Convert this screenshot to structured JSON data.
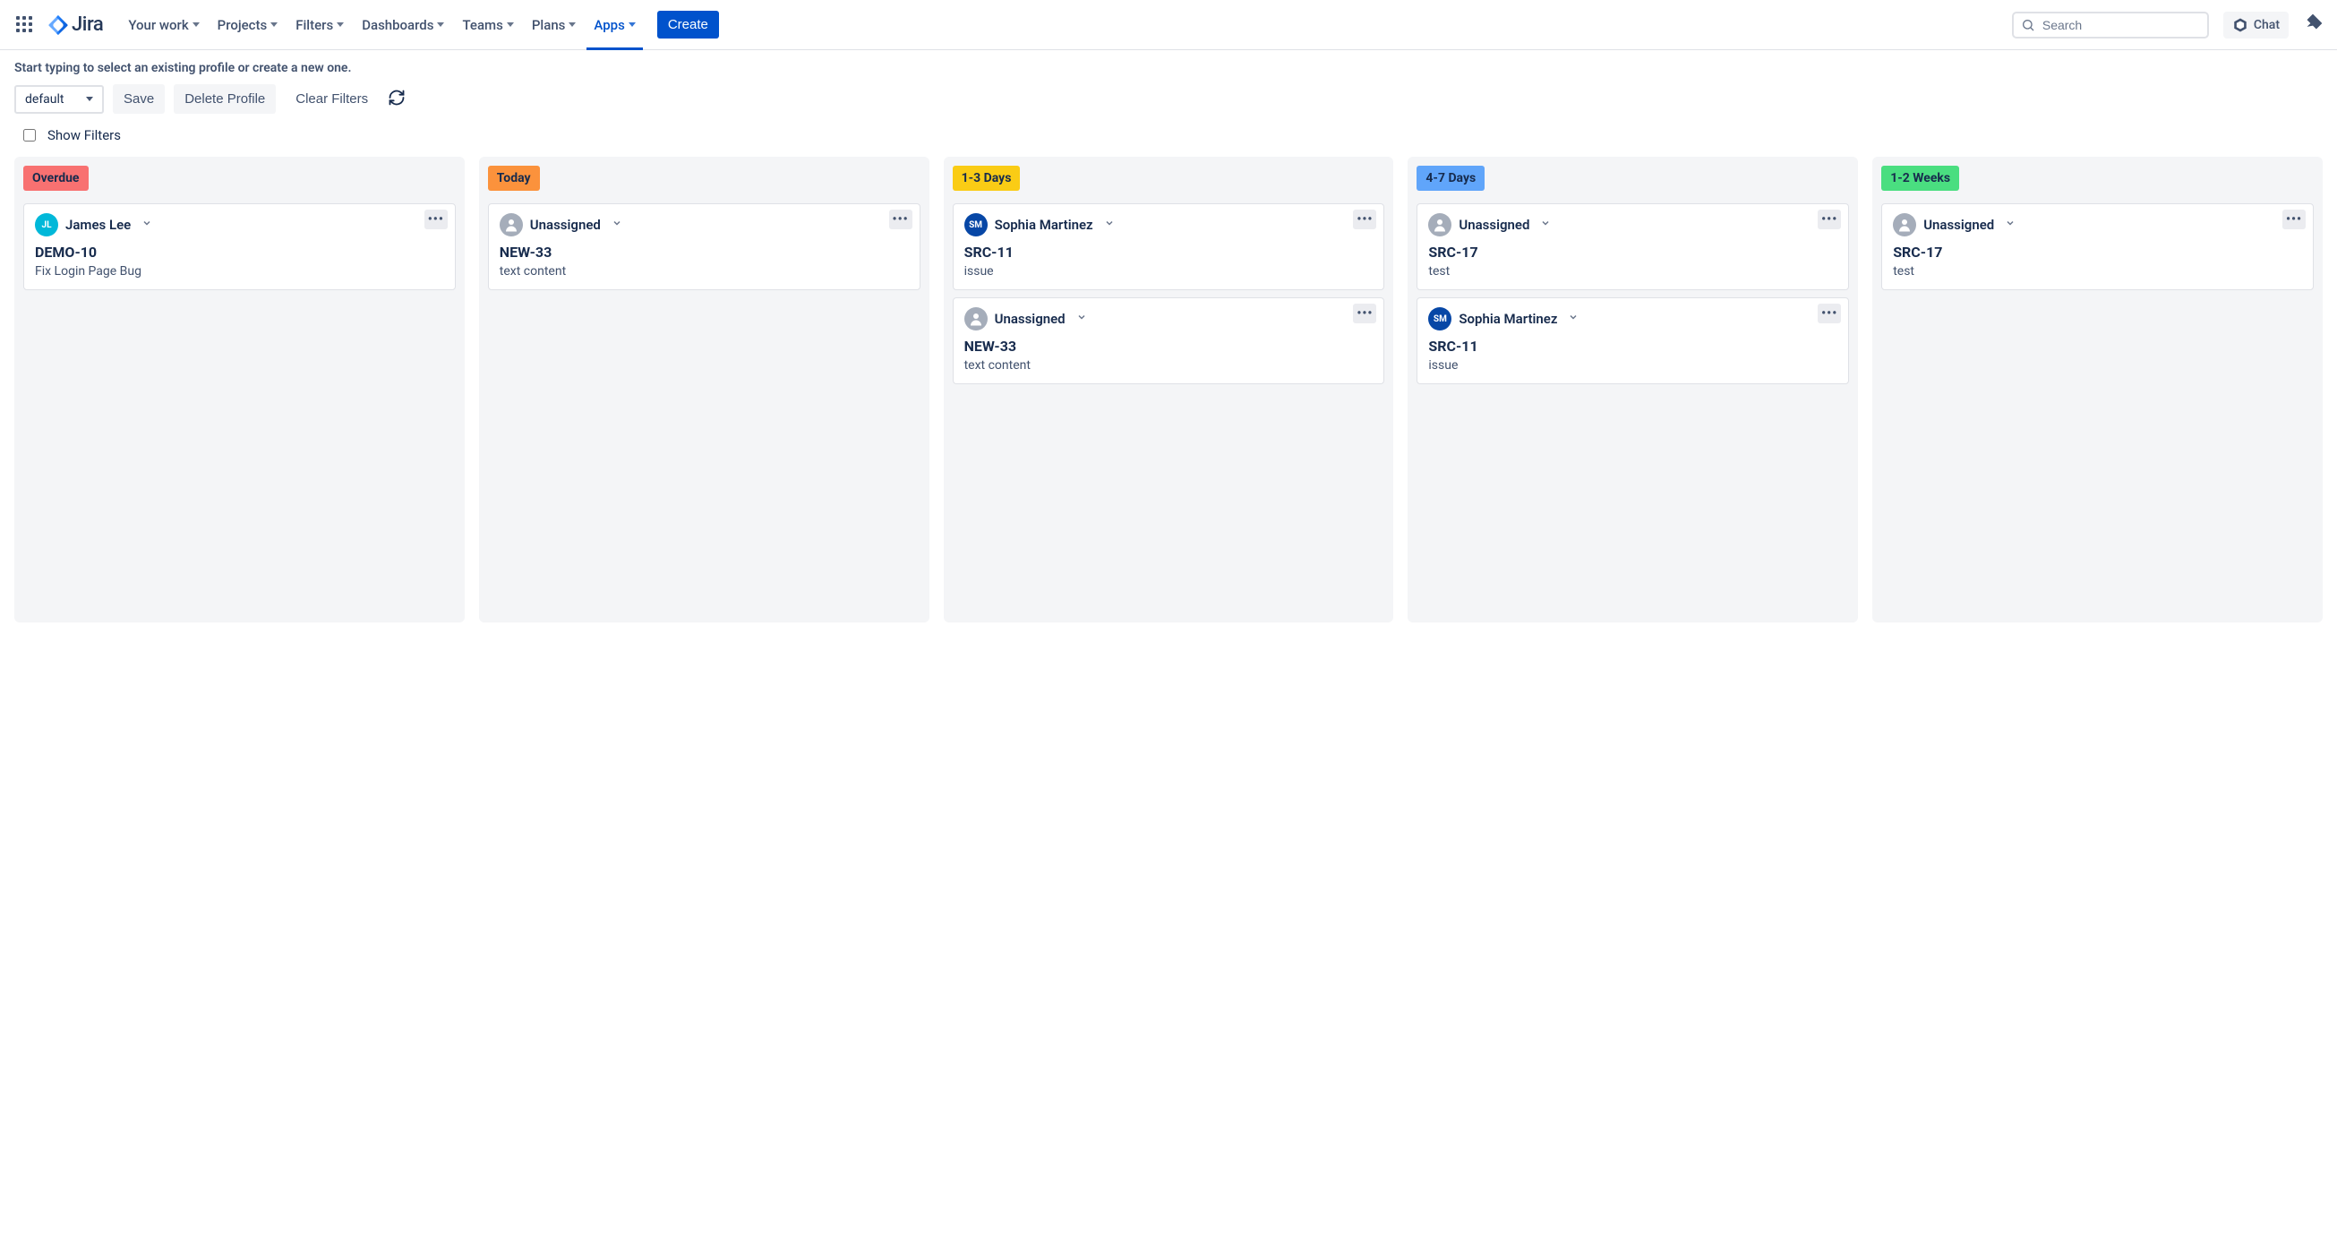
{
  "nav": {
    "product": "Jira",
    "items": [
      {
        "label": "Your work"
      },
      {
        "label": "Projects"
      },
      {
        "label": "Filters"
      },
      {
        "label": "Dashboards"
      },
      {
        "label": "Teams"
      },
      {
        "label": "Plans"
      },
      {
        "label": "Apps",
        "active": true
      }
    ],
    "create": "Create",
    "search_placeholder": "Search",
    "chat": "Chat"
  },
  "toolbar": {
    "hint": "Start typing to select an existing profile or create a new one.",
    "profile_value": "default",
    "save": "Save",
    "delete_profile": "Delete Profile",
    "clear_filters": "Clear Filters",
    "show_filters_label": "Show Filters",
    "show_filters_checked": false
  },
  "colors": {
    "overdue": "#F87171",
    "today": "#FB923C",
    "d1_3": "#FACC15",
    "d4_7": "#60A5FA",
    "w1_2": "#4ADE80",
    "avatar_jl": "#00B8D9",
    "avatar_sm": "#0747A6"
  },
  "board": {
    "columns": [
      {
        "key": "overdue",
        "title": "Overdue",
        "color_key": "overdue",
        "cards": [
          {
            "assignee": "James Lee",
            "initials": "JL",
            "avatar_color_key": "avatar_jl",
            "issue": "DEMO-10",
            "summary": "Fix Login Page Bug"
          }
        ]
      },
      {
        "key": "today",
        "title": "Today",
        "color_key": "today",
        "cards": [
          {
            "assignee": "Unassigned",
            "unassigned": true,
            "issue": "NEW-33",
            "summary": "text content"
          }
        ]
      },
      {
        "key": "d1_3",
        "title": "1-3 Days",
        "color_key": "d1_3",
        "cards": [
          {
            "assignee": "Sophia Martinez",
            "initials": "SM",
            "avatar_color_key": "avatar_sm",
            "issue": "SRC-11",
            "summary": "issue"
          },
          {
            "assignee": "Unassigned",
            "unassigned": true,
            "issue": "NEW-33",
            "summary": "text content"
          }
        ]
      },
      {
        "key": "d4_7",
        "title": "4-7 Days",
        "color_key": "d4_7",
        "cards": [
          {
            "assignee": "Unassigned",
            "unassigned": true,
            "issue": "SRC-17",
            "summary": "test"
          },
          {
            "assignee": "Sophia Martinez",
            "initials": "SM",
            "avatar_color_key": "avatar_sm",
            "issue": "SRC-11",
            "summary": "issue"
          }
        ]
      },
      {
        "key": "w1_2",
        "title": "1-2 Weeks",
        "color_key": "w1_2",
        "cards": [
          {
            "assignee": "Unassigned",
            "unassigned": true,
            "issue": "SRC-17",
            "summary": "test"
          }
        ]
      }
    ]
  }
}
